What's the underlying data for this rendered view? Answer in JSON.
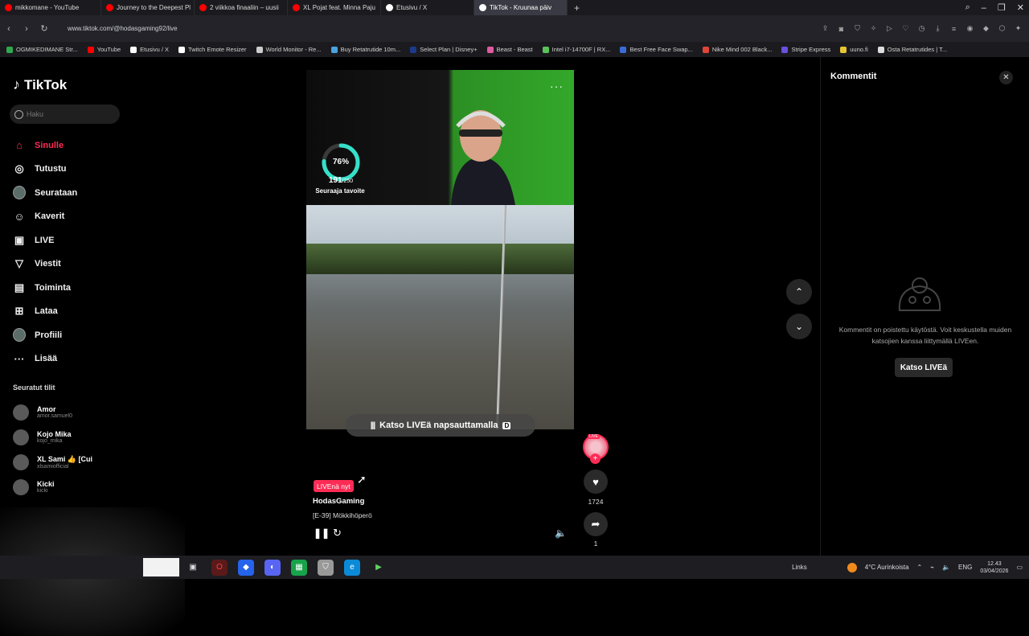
{
  "browser": {
    "tabs": [
      {
        "title": "mikkomane - YouTube",
        "color": "#ff0000"
      },
      {
        "title": "Journey to the Deepest Pl",
        "color": "#ff0000"
      },
      {
        "title": "2 viikkoa finaaliin – uusii",
        "color": "#ff0000"
      },
      {
        "title": "XL Pojat feat. Minna Paju",
        "color": "#ff0000"
      },
      {
        "title": "Etusivu / X",
        "color": "#ffffff"
      },
      {
        "title": "TikTok - Kruunaa päiv",
        "color": "#ffffff",
        "active": true
      }
    ],
    "url": "www.tiktok.com/@hodasgaming92/live",
    "bookmarks": [
      {
        "label": "OGMIKEDIMANE Str...",
        "color": "#2fa84f"
      },
      {
        "label": "YouTube",
        "color": "#ff0000"
      },
      {
        "label": "Etusivu / X",
        "color": "#ffffff"
      },
      {
        "label": "Twitch Emote Resizer",
        "color": "#ffffff"
      },
      {
        "label": "World Monitor - Re...",
        "color": "#cccccc"
      },
      {
        "label": "Buy Retatrutide 10m...",
        "color": "#4aa3df"
      },
      {
        "label": "Select Plan | Disney+",
        "color": "#1d3a8a"
      },
      {
        "label": "Beast - Beast",
        "color": "#e05aa0"
      },
      {
        "label": "Intel i7-14700F | RX...",
        "color": "#59c35a"
      },
      {
        "label": "Best Free Face Swap...",
        "color": "#3b6bd6"
      },
      {
        "label": "Nike Mind 002 Black...",
        "color": "#e0453a"
      },
      {
        "label": "Stripe Express",
        "color": "#6b4fe0"
      },
      {
        "label": "uuno.fi",
        "color": "#e5c533"
      },
      {
        "label": "Osta Retatrutides | T...",
        "color": "#dddddd"
      }
    ]
  },
  "tiktok": {
    "logo": "TikTok",
    "search_placeholder": "Haku",
    "nav": [
      {
        "label": "Sinulle",
        "icon": "home-icon",
        "glyph": "⌂",
        "active": true
      },
      {
        "label": "Tutustu",
        "icon": "compass-icon",
        "glyph": "◎"
      },
      {
        "label": "Seurataan",
        "icon": "avatar",
        "glyph": ""
      },
      {
        "label": "Kaverit",
        "icon": "friends-icon",
        "glyph": "☺"
      },
      {
        "label": "LIVE",
        "icon": "live-icon",
        "glyph": "▣"
      },
      {
        "label": "Viestit",
        "icon": "messages-icon",
        "glyph": "▽"
      },
      {
        "label": "Toiminta",
        "icon": "activity-icon",
        "glyph": "▤"
      },
      {
        "label": "Lataa",
        "icon": "upload-icon",
        "glyph": "⊞"
      },
      {
        "label": "Profiili",
        "icon": "avatar",
        "glyph": ""
      },
      {
        "label": "Lisää",
        "icon": "more-icon",
        "glyph": "···"
      }
    ],
    "following_title": "Seuratut tilit",
    "following": [
      {
        "name": "Amor",
        "handle": "amor.samuel0"
      },
      {
        "name": "Kojo Mika",
        "handle": "kojo_mika"
      },
      {
        "name": "XL Sami 👍 [Cui",
        "handle": "xlsamiofficial"
      },
      {
        "name": "Kicki",
        "handle": "kicki"
      }
    ],
    "goal": {
      "percent": 0.76,
      "percent_label": "76%",
      "current": "191",
      "target": "/250",
      "label": "Seuraaja tavoite"
    },
    "watch_live": {
      "label": "Katso LIVEä napsauttamalla",
      "key": "D"
    },
    "live_badge": "LIVEnä nyt",
    "channel": "HodasGaming",
    "description": "[E-39] Mökkihöperö",
    "likes": "1724",
    "shares": "1",
    "live_mini": "LIVE"
  },
  "comments": {
    "title": "Kommentit",
    "message": "Kommentit on poistettu käytöstä. Voit keskustella muiden katsojien kanssa liittymällä LIVEen.",
    "button": "Katso LIVEä"
  },
  "taskbar": {
    "links": "Links",
    "weather": "4°C  Aurinkoista",
    "lang": "ENG",
    "time": "12.43",
    "date": "03/04/2026"
  },
  "colors": {
    "accent": "#fe2c55",
    "green_screen": "#33a82a"
  }
}
